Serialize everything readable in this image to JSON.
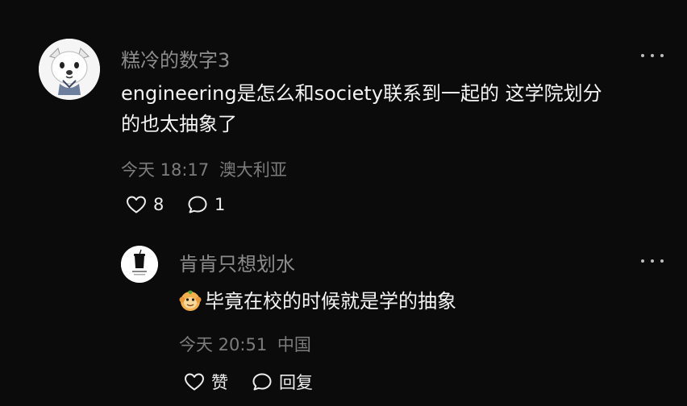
{
  "comments": [
    {
      "username": "糕冷的数字3",
      "text_line1": "engineering是怎么和society联系到一起的 这学院划分",
      "text_line2": "的也太抽象了",
      "date": "今天 18:17",
      "location": "澳大利亚",
      "likes": "8",
      "replies": "1",
      "avatar_icon": "cartoon-dog-avatar"
    },
    {
      "username": "肯肯只想划水",
      "text": "毕竟在校的时候就是学的抽象",
      "emoji_icon": "monkey-face-emoji",
      "date": "今天 20:51",
      "location": "中国",
      "like_label": "赞",
      "reply_label": "回复",
      "avatar_icon": "coffee-cup-avatar"
    }
  ]
}
